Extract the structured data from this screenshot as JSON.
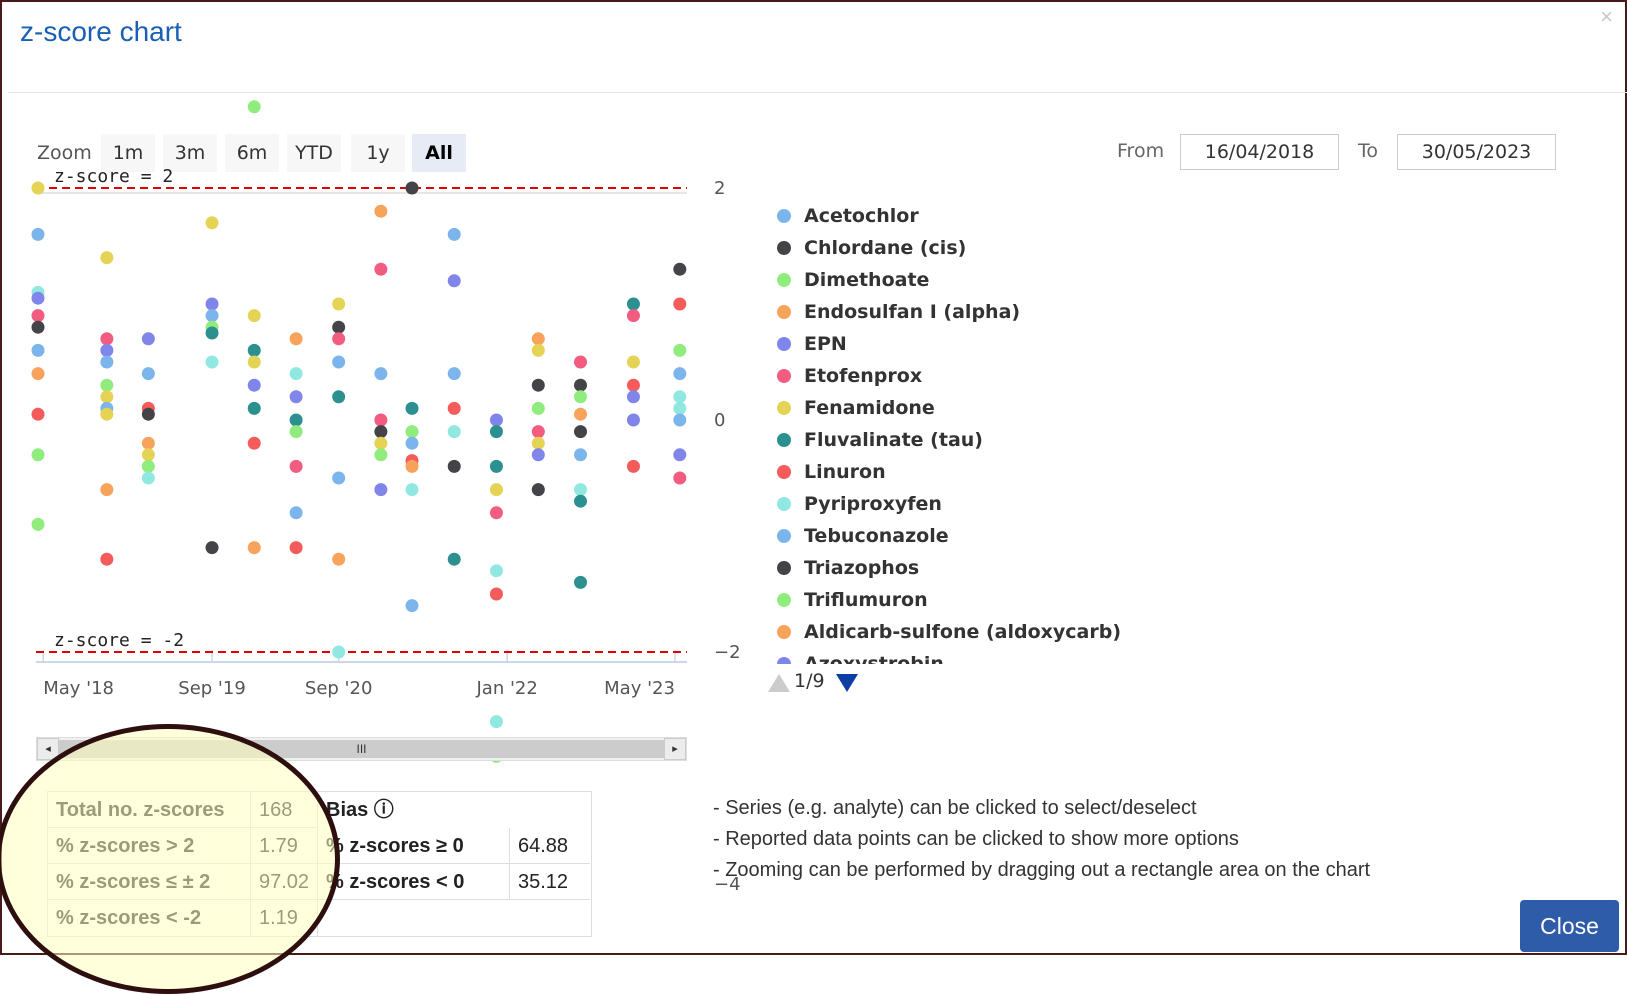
{
  "dialog": {
    "title": "z-score chart",
    "close_icon": "×",
    "close_button": "Close"
  },
  "toolbar": {
    "zoom_label": "Zoom",
    "zoom_buttons": [
      "1m",
      "3m",
      "6m",
      "YTD",
      "1y",
      "All"
    ],
    "active_zoom": "All",
    "from_label": "From",
    "from_value": "16/04/2018",
    "to_label": "To",
    "to_value": "30/05/2023"
  },
  "legend": {
    "items": [
      {
        "name": "Acetochlor",
        "color": "#7cb5ec"
      },
      {
        "name": "Chlordane (cis)",
        "color": "#434348"
      },
      {
        "name": "Dimethoate",
        "color": "#90ed7d"
      },
      {
        "name": "Endosulfan I (alpha)",
        "color": "#f7a35c"
      },
      {
        "name": "EPN",
        "color": "#8085e9"
      },
      {
        "name": "Etofenprox",
        "color": "#f15c80"
      },
      {
        "name": "Fenamidone",
        "color": "#e4d354"
      },
      {
        "name": "Fluvalinate (tau)",
        "color": "#2b908f"
      },
      {
        "name": "Linuron",
        "color": "#f45b5b"
      },
      {
        "name": "Pyriproxyfen",
        "color": "#91e8e1"
      },
      {
        "name": "Tebuconazole",
        "color": "#7cb5ec"
      },
      {
        "name": "Triazophos",
        "color": "#434348"
      },
      {
        "name": "Triflumuron",
        "color": "#90ed7d"
      },
      {
        "name": "Aldicarb-sulfone (aldoxycarb)",
        "color": "#f7a35c"
      },
      {
        "name": "Azoxystrobin",
        "color": "#8085e9"
      }
    ],
    "pager_text": "1/9"
  },
  "scrollbar": {
    "thumb_glyph": "III",
    "left_arrow": "◂",
    "right_arrow": "▸"
  },
  "stats": {
    "total_label": "Total no. z-scores",
    "total_value": "168",
    "gt2_label": "% z-scores > 2",
    "gt2_value": "1.79",
    "within_label": "% z-scores ≤ ± 2",
    "within_value": "97.02",
    "ltm2_label": "% z-scores < -2",
    "ltm2_value": "1.19",
    "bias_label": "Bias ⓘ",
    "ge0_label": "% z-scores ≥ 0",
    "ge0_value": "64.88",
    "lt0_label": "% z-scores < 0",
    "lt0_value": "35.12"
  },
  "notes": [
    "- Series (e.g. analyte) can be clicked to select/deselect",
    "- Reported data points can be clicked to show more options",
    "- Zooming can be performed by dragging out a rectangle area on the chart"
  ],
  "chart_data": {
    "type": "scatter",
    "title": "",
    "xlabel": "",
    "ylabel": "",
    "x_ticks": [
      "May '18",
      "Sep '19",
      "Sep '20",
      "Jan '22",
      "May '23"
    ],
    "x_tick_dates": [
      "2018-05-01",
      "2019-09-01",
      "2020-09-01",
      "2022-01-01",
      "2023-05-01"
    ],
    "y_ticks": [
      2,
      0,
      -2,
      -4
    ],
    "ylim": [
      -4,
      4
    ],
    "xlim": [
      "2018-04-16",
      "2023-05-30"
    ],
    "grid": false,
    "y_axis_side": "right",
    "plot_lines": [
      {
        "value": 2,
        "label": "z-score = 2",
        "color": "#e00000",
        "dash": "dashed"
      },
      {
        "value": -2,
        "label": "z-score = -2",
        "color": "#e00000",
        "dash": "dashed"
      }
    ],
    "points": [
      {
        "date": "2018-04-16",
        "z": 2.0,
        "color": "#e4d354"
      },
      {
        "date": "2018-04-16",
        "z": 1.6,
        "color": "#7cb5ec"
      },
      {
        "date": "2018-04-16",
        "z": 1.1,
        "color": "#91e8e1"
      },
      {
        "date": "2018-04-16",
        "z": 1.05,
        "color": "#8085e9"
      },
      {
        "date": "2018-04-16",
        "z": 0.9,
        "color": "#f15c80"
      },
      {
        "date": "2018-04-16",
        "z": 0.8,
        "color": "#434348"
      },
      {
        "date": "2018-04-16",
        "z": 0.6,
        "color": "#7cb5ec"
      },
      {
        "date": "2018-04-16",
        "z": 0.4,
        "color": "#f7a35c"
      },
      {
        "date": "2018-04-16",
        "z": 0.05,
        "color": "#f45b5b"
      },
      {
        "date": "2018-04-16",
        "z": -0.3,
        "color": "#90ed7d"
      },
      {
        "date": "2018-04-16",
        "z": -0.9,
        "color": "#90ed7d"
      },
      {
        "date": "2018-11-01",
        "z": 1.4,
        "color": "#e4d354"
      },
      {
        "date": "2018-11-01",
        "z": 0.7,
        "color": "#f15c80"
      },
      {
        "date": "2018-11-01",
        "z": 0.6,
        "color": "#8085e9"
      },
      {
        "date": "2018-11-01",
        "z": 0.5,
        "color": "#7cb5ec"
      },
      {
        "date": "2018-11-01",
        "z": 0.3,
        "color": "#90ed7d"
      },
      {
        "date": "2018-11-01",
        "z": 0.2,
        "color": "#e4d354"
      },
      {
        "date": "2018-11-01",
        "z": 0.1,
        "color": "#7cb5ec"
      },
      {
        "date": "2018-11-01",
        "z": 0.05,
        "color": "#e4d354"
      },
      {
        "date": "2018-11-01",
        "z": -0.6,
        "color": "#f7a35c"
      },
      {
        "date": "2018-11-01",
        "z": -1.2,
        "color": "#f45b5b"
      },
      {
        "date": "2019-03-01",
        "z": 0.7,
        "color": "#8085e9"
      },
      {
        "date": "2019-03-01",
        "z": 0.4,
        "color": "#7cb5ec"
      },
      {
        "date": "2019-03-01",
        "z": 0.1,
        "color": "#f45b5b"
      },
      {
        "date": "2019-03-01",
        "z": 0.05,
        "color": "#434348"
      },
      {
        "date": "2019-03-01",
        "z": -0.2,
        "color": "#f7a35c"
      },
      {
        "date": "2019-03-01",
        "z": -0.3,
        "color": "#e4d354"
      },
      {
        "date": "2019-03-01",
        "z": -0.4,
        "color": "#90ed7d"
      },
      {
        "date": "2019-03-01",
        "z": -0.5,
        "color": "#91e8e1"
      },
      {
        "date": "2019-09-01",
        "z": 1.7,
        "color": "#e4d354"
      },
      {
        "date": "2019-09-01",
        "z": 1.0,
        "color": "#8085e9"
      },
      {
        "date": "2019-09-01",
        "z": 0.9,
        "color": "#7cb5ec"
      },
      {
        "date": "2019-09-01",
        "z": 0.8,
        "color": "#90ed7d"
      },
      {
        "date": "2019-09-01",
        "z": 0.75,
        "color": "#2b908f"
      },
      {
        "date": "2019-09-01",
        "z": 0.5,
        "color": "#91e8e1"
      },
      {
        "date": "2019-09-01",
        "z": -1.1,
        "color": "#434348"
      },
      {
        "date": "2020-01-01",
        "z": 2.7,
        "color": "#90ed7d"
      },
      {
        "date": "2020-01-01",
        "z": 0.9,
        "color": "#e4d354"
      },
      {
        "date": "2020-01-01",
        "z": 0.6,
        "color": "#2b908f"
      },
      {
        "date": "2020-01-01",
        "z": 0.5,
        "color": "#e4d354"
      },
      {
        "date": "2020-01-01",
        "z": 0.3,
        "color": "#8085e9"
      },
      {
        "date": "2020-01-01",
        "z": 0.1,
        "color": "#2b908f"
      },
      {
        "date": "2020-01-01",
        "z": -0.2,
        "color": "#f45b5b"
      },
      {
        "date": "2020-01-01",
        "z": -1.1,
        "color": "#f7a35c"
      },
      {
        "date": "2020-05-01",
        "z": 0.7,
        "color": "#f7a35c"
      },
      {
        "date": "2020-05-01",
        "z": 0.4,
        "color": "#91e8e1"
      },
      {
        "date": "2020-05-01",
        "z": 0.2,
        "color": "#8085e9"
      },
      {
        "date": "2020-05-01",
        "z": 0.0,
        "color": "#2b908f"
      },
      {
        "date": "2020-05-01",
        "z": -0.1,
        "color": "#90ed7d"
      },
      {
        "date": "2020-05-01",
        "z": -0.4,
        "color": "#f15c80"
      },
      {
        "date": "2020-05-01",
        "z": -0.8,
        "color": "#7cb5ec"
      },
      {
        "date": "2020-05-01",
        "z": -1.1,
        "color": "#f45b5b"
      },
      {
        "date": "2020-09-01",
        "z": 1.0,
        "color": "#e4d354"
      },
      {
        "date": "2020-09-01",
        "z": 0.8,
        "color": "#434348"
      },
      {
        "date": "2020-09-01",
        "z": 0.7,
        "color": "#f15c80"
      },
      {
        "date": "2020-09-01",
        "z": 0.5,
        "color": "#7cb5ec"
      },
      {
        "date": "2020-09-01",
        "z": 0.2,
        "color": "#2b908f"
      },
      {
        "date": "2020-09-01",
        "z": -0.5,
        "color": "#7cb5ec"
      },
      {
        "date": "2020-09-01",
        "z": -1.2,
        "color": "#f7a35c"
      },
      {
        "date": "2020-09-01",
        "z": -2.0,
        "color": "#91e8e1"
      },
      {
        "date": "2021-01-01",
        "z": 1.8,
        "color": "#f7a35c"
      },
      {
        "date": "2021-01-01",
        "z": 1.3,
        "color": "#f15c80"
      },
      {
        "date": "2021-01-01",
        "z": 0.4,
        "color": "#7cb5ec"
      },
      {
        "date": "2021-01-01",
        "z": 0.0,
        "color": "#f15c80"
      },
      {
        "date": "2021-01-01",
        "z": -0.1,
        "color": "#434348"
      },
      {
        "date": "2021-01-01",
        "z": -0.2,
        "color": "#e4d354"
      },
      {
        "date": "2021-01-01",
        "z": -0.3,
        "color": "#90ed7d"
      },
      {
        "date": "2021-01-01",
        "z": -0.6,
        "color": "#8085e9"
      },
      {
        "date": "2021-04-01",
        "z": 2.0,
        "color": "#434348"
      },
      {
        "date": "2021-04-01",
        "z": 0.1,
        "color": "#2b908f"
      },
      {
        "date": "2021-04-01",
        "z": -0.1,
        "color": "#90ed7d"
      },
      {
        "date": "2021-04-01",
        "z": -0.2,
        "color": "#7cb5ec"
      },
      {
        "date": "2021-04-01",
        "z": -0.35,
        "color": "#f45b5b"
      },
      {
        "date": "2021-04-01",
        "z": -0.4,
        "color": "#f7a35c"
      },
      {
        "date": "2021-04-01",
        "z": -0.6,
        "color": "#91e8e1"
      },
      {
        "date": "2021-04-01",
        "z": -1.6,
        "color": "#7cb5ec"
      },
      {
        "date": "2021-08-01",
        "z": 1.6,
        "color": "#7cb5ec"
      },
      {
        "date": "2021-08-01",
        "z": 1.2,
        "color": "#8085e9"
      },
      {
        "date": "2021-08-01",
        "z": 0.4,
        "color": "#7cb5ec"
      },
      {
        "date": "2021-08-01",
        "z": 0.1,
        "color": "#f45b5b"
      },
      {
        "date": "2021-08-01",
        "z": -0.1,
        "color": "#91e8e1"
      },
      {
        "date": "2021-08-01",
        "z": -0.4,
        "color": "#434348"
      },
      {
        "date": "2021-08-01",
        "z": -1.2,
        "color": "#2b908f"
      },
      {
        "date": "2021-12-01",
        "z": 0.0,
        "color": "#8085e9"
      },
      {
        "date": "2021-12-01",
        "z": -0.1,
        "color": "#2b908f"
      },
      {
        "date": "2021-12-01",
        "z": -0.4,
        "color": "#2b908f"
      },
      {
        "date": "2021-12-01",
        "z": -0.6,
        "color": "#e4d354"
      },
      {
        "date": "2021-12-01",
        "z": -0.8,
        "color": "#f15c80"
      },
      {
        "date": "2021-12-01",
        "z": -1.3,
        "color": "#91e8e1"
      },
      {
        "date": "2021-12-01",
        "z": -1.5,
        "color": "#f45b5b"
      },
      {
        "date": "2021-12-01",
        "z": -2.6,
        "color": "#91e8e1"
      },
      {
        "date": "2021-12-01",
        "z": -2.9,
        "color": "#90ed7d"
      },
      {
        "date": "2022-04-01",
        "z": 0.7,
        "color": "#f7a35c"
      },
      {
        "date": "2022-04-01",
        "z": 0.6,
        "color": "#e4d354"
      },
      {
        "date": "2022-04-01",
        "z": 0.3,
        "color": "#434348"
      },
      {
        "date": "2022-04-01",
        "z": 0.1,
        "color": "#90ed7d"
      },
      {
        "date": "2022-04-01",
        "z": -0.1,
        "color": "#f15c80"
      },
      {
        "date": "2022-04-01",
        "z": -0.2,
        "color": "#e4d354"
      },
      {
        "date": "2022-04-01",
        "z": -0.3,
        "color": "#8085e9"
      },
      {
        "date": "2022-04-01",
        "z": -0.6,
        "color": "#434348"
      },
      {
        "date": "2022-08-01",
        "z": 0.5,
        "color": "#f15c80"
      },
      {
        "date": "2022-08-01",
        "z": 0.3,
        "color": "#434348"
      },
      {
        "date": "2022-08-01",
        "z": 0.2,
        "color": "#90ed7d"
      },
      {
        "date": "2022-08-01",
        "z": 0.05,
        "color": "#f7a35c"
      },
      {
        "date": "2022-08-01",
        "z": -0.1,
        "color": "#434348"
      },
      {
        "date": "2022-08-01",
        "z": -0.3,
        "color": "#7cb5ec"
      },
      {
        "date": "2022-08-01",
        "z": -0.6,
        "color": "#91e8e1"
      },
      {
        "date": "2022-08-01",
        "z": -0.7,
        "color": "#2b908f"
      },
      {
        "date": "2022-08-01",
        "z": -1.4,
        "color": "#2b908f"
      },
      {
        "date": "2023-01-01",
        "z": 1.0,
        "color": "#2b908f"
      },
      {
        "date": "2023-01-01",
        "z": 0.9,
        "color": "#f15c80"
      },
      {
        "date": "2023-01-01",
        "z": 0.5,
        "color": "#e4d354"
      },
      {
        "date": "2023-01-01",
        "z": 0.3,
        "color": "#f45b5b"
      },
      {
        "date": "2023-01-01",
        "z": 0.2,
        "color": "#8085e9"
      },
      {
        "date": "2023-01-01",
        "z": 0.0,
        "color": "#8085e9"
      },
      {
        "date": "2023-01-01",
        "z": -0.4,
        "color": "#f45b5b"
      },
      {
        "date": "2023-05-15",
        "z": 1.3,
        "color": "#434348"
      },
      {
        "date": "2023-05-15",
        "z": 1.0,
        "color": "#f45b5b"
      },
      {
        "date": "2023-05-15",
        "z": 0.6,
        "color": "#90ed7d"
      },
      {
        "date": "2023-05-15",
        "z": 0.4,
        "color": "#7cb5ec"
      },
      {
        "date": "2023-05-15",
        "z": 0.2,
        "color": "#91e8e1"
      },
      {
        "date": "2023-05-15",
        "z": 0.1,
        "color": "#91e8e1"
      },
      {
        "date": "2023-05-15",
        "z": 0.0,
        "color": "#7cb5ec"
      },
      {
        "date": "2023-05-15",
        "z": -0.3,
        "color": "#8085e9"
      },
      {
        "date": "2023-05-15",
        "z": -0.5,
        "color": "#f15c80"
      }
    ]
  }
}
